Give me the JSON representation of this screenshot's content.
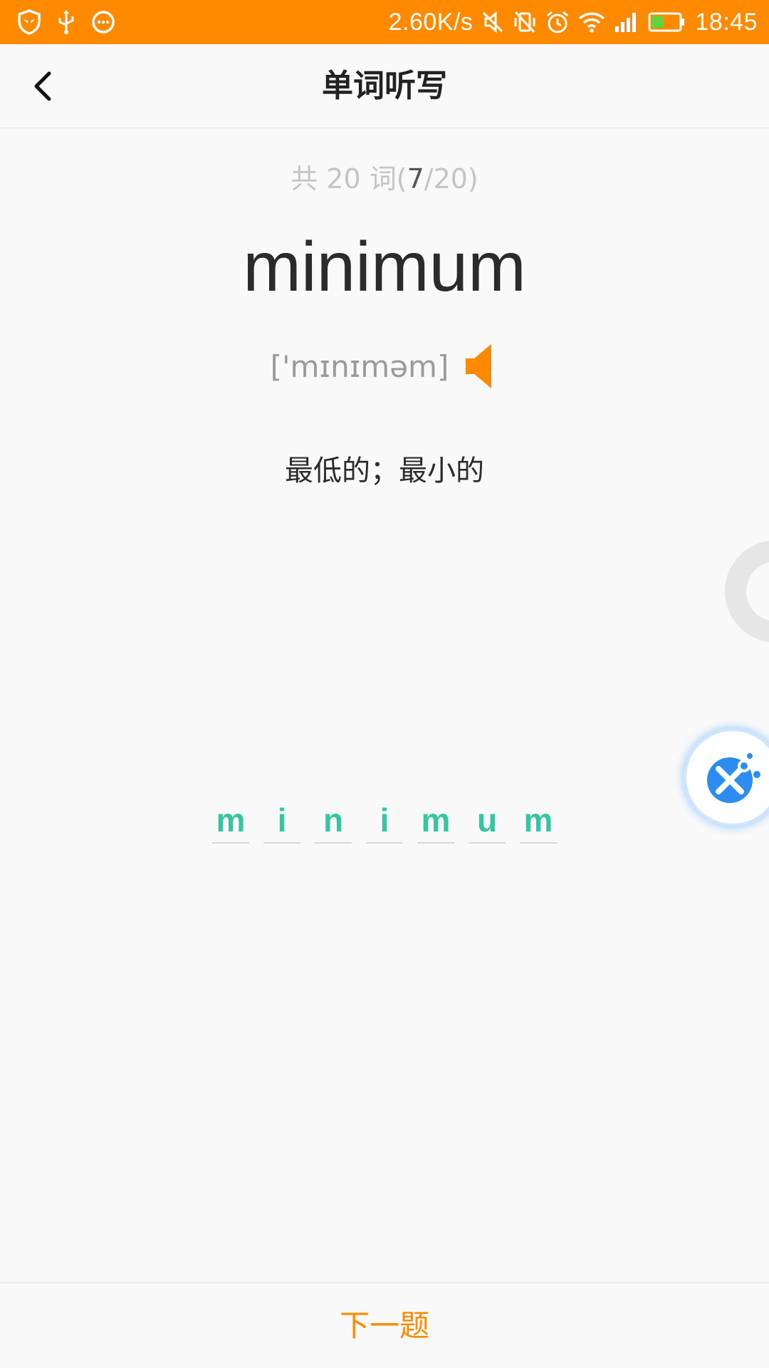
{
  "status_bar": {
    "left_icons": [
      "shield-icon",
      "usb-icon",
      "chat-bubble-icon"
    ],
    "net_speed": "2.60K/s",
    "right_icons": [
      "mute-icon",
      "vibrate-off-icon",
      "alarm-icon",
      "wifi-icon",
      "signal-icon",
      "battery-icon"
    ],
    "time": "18:45",
    "background_color": "#ff8a00"
  },
  "header": {
    "title": "单词听写",
    "back_icon": "chevron-left-icon"
  },
  "progress": {
    "prefix": "共 20 词(",
    "current": "7",
    "suffix": "/20)"
  },
  "word": {
    "text": "minimum",
    "phonetic": "['mɪnɪməm]",
    "speaker_icon": "speaker-icon",
    "meaning": "最低的；最小的"
  },
  "letters": [
    "m",
    "i",
    "n",
    "i",
    "m",
    "u",
    "m"
  ],
  "float_button": {
    "icon": "satellite-icon",
    "color": "#2d8cf0"
  },
  "footer": {
    "next_label": "下一题",
    "accent_color": "#ff8a00"
  }
}
